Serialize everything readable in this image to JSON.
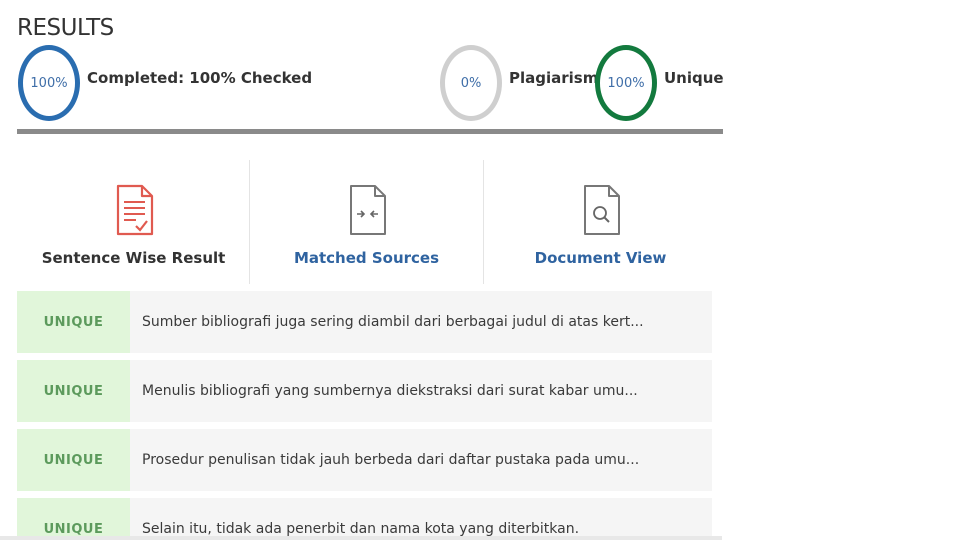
{
  "results": {
    "title": "RESULTS",
    "completed": {
      "value": "100%",
      "label": "Completed: 100% Checked"
    },
    "plagiarism": {
      "value": "0%",
      "label": "Plagiarism"
    },
    "unique": {
      "value": "100%",
      "label": "Unique"
    }
  },
  "tabs": [
    {
      "label": "Sentence Wise Result",
      "icon": "sentence-wise-icon",
      "color": "#333333"
    },
    {
      "label": "Matched Sources",
      "icon": "matched-sources-icon",
      "color": "#2f63a0"
    },
    {
      "label": "Document View",
      "icon": "document-view-icon",
      "color": "#2f63a0"
    }
  ],
  "sentences": [
    {
      "status": "UNIQUE",
      "text": "Sumber bibliografi juga sering diambil dari berbagai judul di atas kert..."
    },
    {
      "status": "UNIQUE",
      "text": "Menulis bibliografi yang sumbernya diekstraksi dari surat kabar umu..."
    },
    {
      "status": "UNIQUE",
      "text": "Prosedur penulisan tidak jauh berbeda dari daftar pustaka pada umu..."
    },
    {
      "status": "UNIQUE",
      "text": "Selain itu, tidak ada penerbit dan nama kota yang diterbitkan."
    }
  ],
  "colors": {
    "completed_ring": "#2a6db0",
    "plagiarism_ring": "#cfcfcf",
    "unique_ring": "#137a3e",
    "unique_badge_bg": "#e1f6da",
    "icon_red": "#e05a50"
  }
}
